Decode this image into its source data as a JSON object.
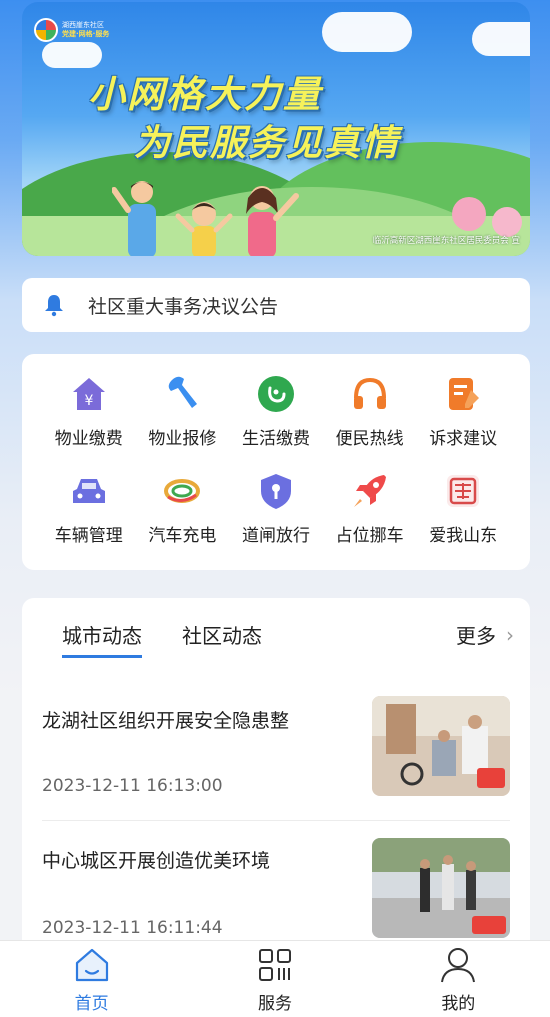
{
  "banner": {
    "logo_line1": "湖西崖东社区",
    "logo_line2": "党建·网格·服务",
    "slogan_line1": "小网格大力量",
    "slogan_line2": "为民服务见真情",
    "caption": "临沂高新区湖西崖东社区居民委员会 宣"
  },
  "notice": {
    "text": "社区重大事务决议公告",
    "icon": "bell-icon"
  },
  "services": [
    {
      "label": "物业缴费",
      "icon": "house-yen-icon",
      "color": "#7b6bd9"
    },
    {
      "label": "物业报修",
      "icon": "wrench-icon",
      "color": "#3b8ff0"
    },
    {
      "label": "生活缴费",
      "icon": "payment-circle-icon",
      "color": "#2fa84f"
    },
    {
      "label": "便民热线",
      "icon": "headset-icon",
      "color": "#f07b2a"
    },
    {
      "label": "诉求建议",
      "icon": "edit-note-icon",
      "color": "#f07b2a"
    },
    {
      "label": "车辆管理",
      "icon": "car-icon",
      "color": "#6b6fe0"
    },
    {
      "label": "汽车充电",
      "icon": "charging-icon",
      "color": "#e8a93a"
    },
    {
      "label": "道闸放行",
      "icon": "shield-icon",
      "color": "#6b6fe0"
    },
    {
      "label": "占位挪车",
      "icon": "rocket-icon",
      "color": "#ef4a4a"
    },
    {
      "label": "爱我山东",
      "icon": "seal-icon",
      "color": "#d84a4a"
    }
  ],
  "news": {
    "tabs": [
      "城市动态",
      "社区动态"
    ],
    "active_tab": "城市动态",
    "more_label": "更多",
    "items": [
      {
        "title": "龙湖社区组织开展安全隐患整",
        "time": "2023-12-11 16:13:00"
      },
      {
        "title": "中心城区开展创造优美环境",
        "time": "2023-12-11 16:11:44"
      }
    ]
  },
  "bottom_nav": [
    {
      "label": "首页",
      "icon": "home-icon",
      "active": true
    },
    {
      "label": "服务",
      "icon": "grid-icon",
      "active": false
    },
    {
      "label": "我的",
      "icon": "user-icon",
      "active": false
    }
  ],
  "colors": {
    "accent": "#2f7be0",
    "page_top": "#3d8ff0"
  }
}
